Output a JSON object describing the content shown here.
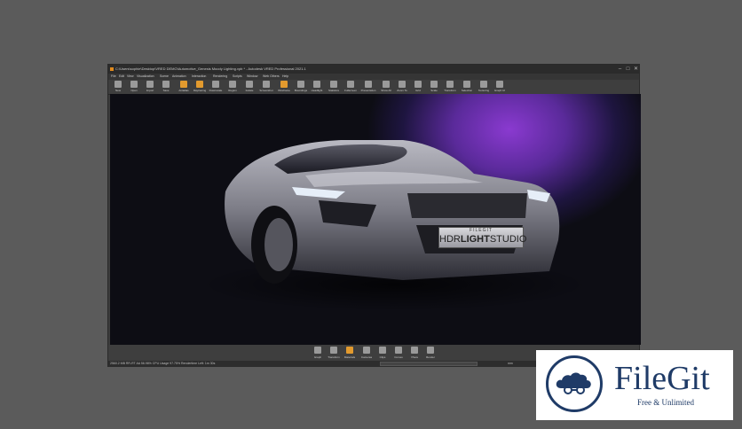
{
  "window": {
    "title": "C:\\Users\\sophie\\Desktop\\VRED DEMO\\Automotive_Genesis Moody Lighting.vpb * - Autodesk VRED Professional 2021.1",
    "controls": [
      "–",
      "□",
      "✕"
    ]
  },
  "menu": [
    "File",
    "Edit",
    "View",
    "Visualization",
    "Scene",
    "Animation",
    "Interaction",
    "Rendering",
    "Scripts",
    "Window",
    "Web Others",
    "Help"
  ],
  "toolbar": [
    {
      "label": "New",
      "icon": "new-file-icon"
    },
    {
      "label": "Open",
      "icon": "open-folder-icon"
    },
    {
      "label": "Import",
      "icon": "import-icon"
    },
    {
      "label": "Save",
      "icon": "save-icon"
    },
    {
      "label": "Antialias",
      "icon": "antialias-icon",
      "active": true
    },
    {
      "label": "Raytracing",
      "icon": "raytracing-icon",
      "active": true
    },
    {
      "label": "Downscale",
      "icon": "downscale-icon"
    },
    {
      "label": "Region",
      "icon": "region-icon"
    },
    {
      "label": "Isolate",
      "icon": "isolate-icon"
    },
    {
      "label": "Screenshot",
      "icon": "screenshot-icon"
    },
    {
      "label": "Wireframe",
      "icon": "wireframe-icon",
      "active": true
    },
    {
      "label": "Boundings",
      "icon": "boundings-icon"
    },
    {
      "label": "Headlight",
      "icon": "headlight-icon"
    },
    {
      "label": "Statistics",
      "icon": "statistics-icon"
    },
    {
      "label": "Fullscreen",
      "icon": "fullscreen-icon"
    },
    {
      "label": "Presentation",
      "icon": "presentation-icon"
    },
    {
      "label": "Show All",
      "icon": "show-all-icon"
    },
    {
      "label": "Zoom To",
      "icon": "zoom-to-icon"
    },
    {
      "label": "Grid",
      "icon": "grid-icon"
    },
    {
      "label": "Scale",
      "icon": "scale-icon"
    },
    {
      "label": "Transform",
      "icon": "transform-icon"
    },
    {
      "label": "Selection",
      "icon": "selection-icon"
    },
    {
      "label": "Texturing",
      "icon": "texturing-icon"
    },
    {
      "label": "Graph UI",
      "icon": "graph-ui-icon"
    }
  ],
  "signin": "Sign in",
  "viewport": {
    "badge_top": "FILEGIT",
    "badge_text_1": "HDR",
    "badge_text_2": "LIGHT",
    "badge_text_3": "STUDIO"
  },
  "bottom_tools": [
    {
      "label": "Graph",
      "icon": "graph-icon"
    },
    {
      "label": "Transform",
      "icon": "transform-icon"
    },
    {
      "label": "Materials",
      "icon": "materials-icon",
      "active": true
    },
    {
      "label": "Cameras",
      "icon": "cameras-icon"
    },
    {
      "label": "Clips",
      "icon": "clips-icon"
    },
    {
      "label": "Curves",
      "icon": "curves-icon"
    },
    {
      "label": "VSets",
      "icon": "vsets-icon"
    },
    {
      "label": "Render",
      "icon": "render-icon"
    }
  ],
  "status": {
    "left": "2560.2 MB  RR-RT  AA  56.96%  CPU Usage 97.75%  Rendertime Left: 1m 30s",
    "field_placeholder": "",
    "units": "mm"
  },
  "watermark": {
    "name": "FileGit",
    "tagline": "Free & Unlimited"
  },
  "colors": {
    "accent_orange": "#e29a2e",
    "brand_navy": "#1f3b67",
    "viewport_glow": "#8a3ad0"
  }
}
